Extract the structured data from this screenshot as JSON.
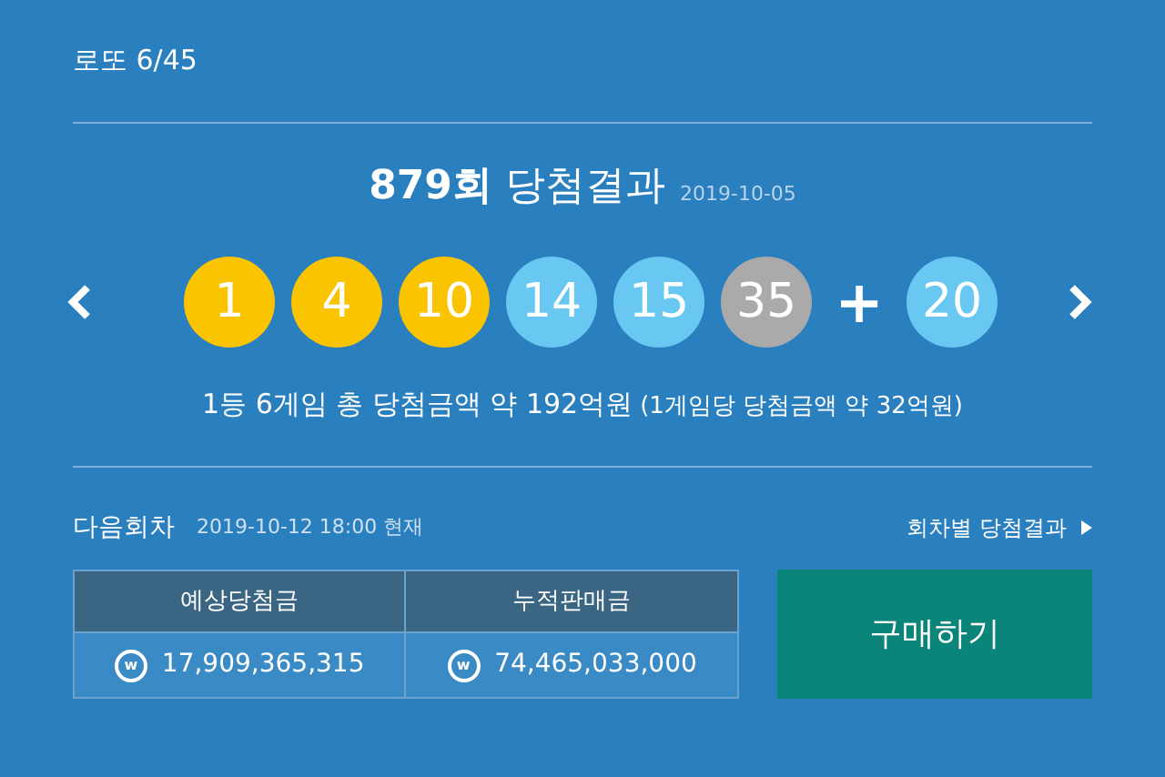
{
  "header": {
    "title": "로또 6/45"
  },
  "result": {
    "round": "879회",
    "title": "당첨결과",
    "date": "2019-10-05",
    "balls": [
      {
        "number": "1",
        "color": "#fbc400"
      },
      {
        "number": "4",
        "color": "#fbc400"
      },
      {
        "number": "10",
        "color": "#fbc400"
      },
      {
        "number": "14",
        "color": "#69c8f2"
      },
      {
        "number": "15",
        "color": "#69c8f2"
      },
      {
        "number": "35",
        "color": "#aaaaaa"
      }
    ],
    "plus": "+",
    "bonus": {
      "number": "20",
      "color": "#69c8f2"
    },
    "summary": "1등 6게임 총 당첨금액 약 192억원",
    "summary_detail": "(1게임당 당첨금액 약 32억원)"
  },
  "next": {
    "title": "다음회차",
    "as_of": "2019-10-12 18:00 현재",
    "link": "회차별 당첨결과",
    "table": {
      "columns": [
        "예상당첨금",
        "누적판매금"
      ],
      "values": [
        {
          "symbol": "w",
          "amount": "17,909,365,315"
        },
        {
          "symbol": "w",
          "amount": "74,465,033,000"
        }
      ]
    },
    "buy_button": "구매하기"
  }
}
